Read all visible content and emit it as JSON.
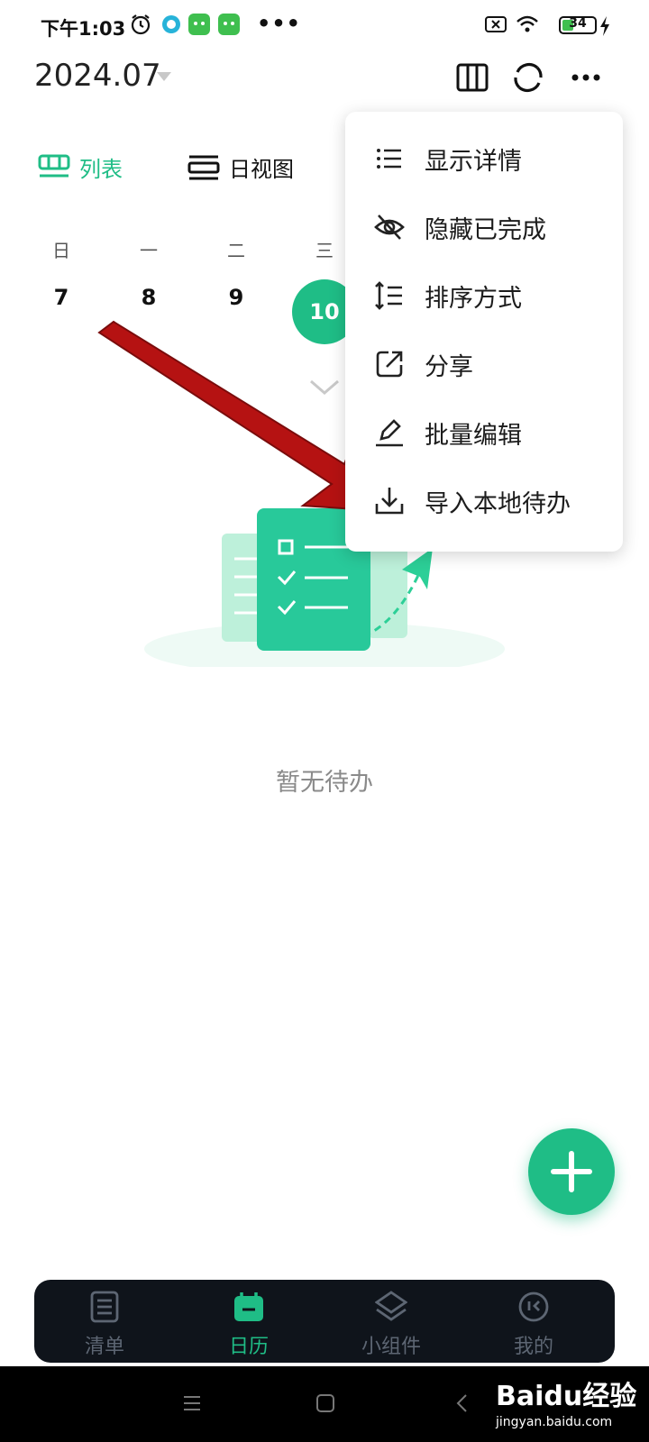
{
  "status_bar": {
    "time": "下午1:03",
    "battery": "34",
    "dots": "•••"
  },
  "header": {
    "month": "2024.07"
  },
  "view_toggle": {
    "list_label": "列表",
    "day_label": "日视图"
  },
  "week": {
    "weekdays": [
      "日",
      "一",
      "二",
      "三"
    ],
    "days": [
      "7",
      "8",
      "9",
      "10"
    ],
    "selected_day": "10"
  },
  "menu": {
    "items": [
      {
        "label": "显示详情",
        "icon": "list-icon"
      },
      {
        "label": "隐藏已完成",
        "icon": "eye-off-icon"
      },
      {
        "label": "排序方式",
        "icon": "sort-icon"
      },
      {
        "label": "分享",
        "icon": "share-icon"
      },
      {
        "label": "批量编辑",
        "icon": "edit-icon"
      },
      {
        "label": "导入本地待办",
        "icon": "download-icon"
      }
    ]
  },
  "empty_state": {
    "text": "暂无待办"
  },
  "bottom_nav": {
    "items": [
      {
        "label": "清单",
        "icon": "list-doc-icon"
      },
      {
        "label": "日历",
        "icon": "calendar-icon",
        "active": true
      },
      {
        "label": "小组件",
        "icon": "layers-icon"
      },
      {
        "label": "我的",
        "icon": "profile-icon"
      }
    ]
  },
  "watermark": {
    "main": "Baidu经验",
    "sub": "jingyan.baidu.com"
  },
  "colors": {
    "accent": "#1fbd86",
    "annotation_arrow": "#b51212",
    "nav_bg": "#0f141b"
  }
}
